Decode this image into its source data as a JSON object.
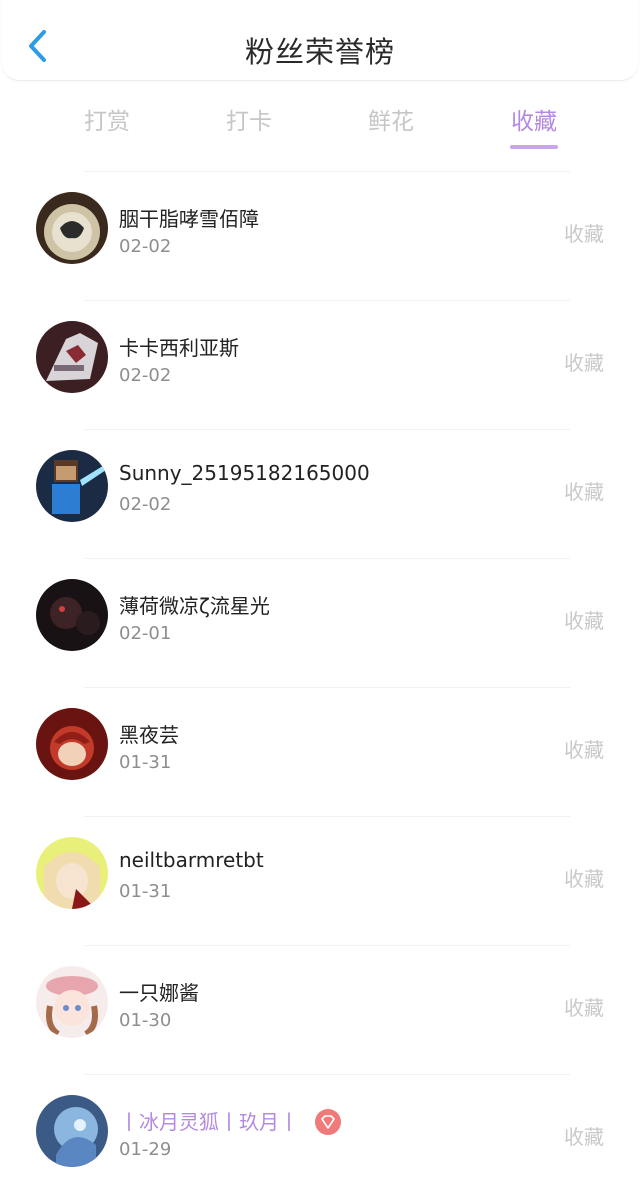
{
  "header": {
    "title": "粉丝荣誉榜"
  },
  "tabs": [
    "打赏",
    "打卡",
    "鲜花",
    "收藏"
  ],
  "active_tab_index": 3,
  "fans": [
    {
      "name": "胭干脂哮雪佰障",
      "date": "02-02",
      "action": "收藏"
    },
    {
      "name": "卡卡西利亚斯",
      "date": "02-02",
      "action": "收藏"
    },
    {
      "name": "Sunny_25195182165000",
      "date": "02-02",
      "action": "收藏"
    },
    {
      "name": "薄荷微凉ζ流星光",
      "date": "02-01",
      "action": "收藏"
    },
    {
      "name": "黑夜芸",
      "date": "01-31",
      "action": "收藏"
    },
    {
      "name": "neiltbarmretbt",
      "date": "01-31",
      "action": "收藏"
    },
    {
      "name": "一只娜酱",
      "date": "01-30",
      "action": "收藏"
    },
    {
      "name": "丨冰月灵狐丨玖月丨",
      "date": "01-29",
      "action": "收藏",
      "badge": "diamond-badge"
    }
  ],
  "colors": {
    "accent": "#b48ae0",
    "back": "#2f9be8",
    "badge": "#f07a7a"
  }
}
